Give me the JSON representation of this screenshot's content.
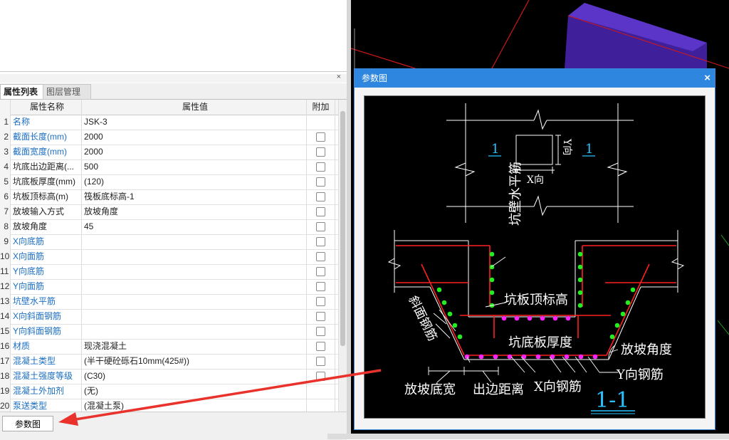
{
  "tabs": {
    "attr_list": "属性列表",
    "layer_mgmt": "图层管理"
  },
  "close_glyph": "×",
  "headers": {
    "name": "属性名称",
    "value": "属性值",
    "extra": "附加"
  },
  "rows": [
    {
      "num": "1",
      "name": "名称",
      "value": "JSK-3",
      "blue": true,
      "check": false
    },
    {
      "num": "2",
      "name": "截面长度(mm)",
      "value": "2000",
      "blue": true,
      "check": true
    },
    {
      "num": "3",
      "name": "截面宽度(mm)",
      "value": "2000",
      "blue": true,
      "check": true
    },
    {
      "num": "4",
      "name": "坑底出边距离(...",
      "value": "500",
      "blue": false,
      "check": true
    },
    {
      "num": "5",
      "name": "坑底板厚度(mm)",
      "value": "(120)",
      "blue": false,
      "check": true
    },
    {
      "num": "6",
      "name": "坑板顶标高(m)",
      "value": "筏板底标高-1",
      "blue": false,
      "check": true
    },
    {
      "num": "7",
      "name": "放坡输入方式",
      "value": "放坡角度",
      "blue": false,
      "check": true
    },
    {
      "num": "8",
      "name": "放坡角度",
      "value": "45",
      "blue": false,
      "check": true
    },
    {
      "num": "9",
      "name": "X向底筋",
      "value": "",
      "blue": true,
      "check": true
    },
    {
      "num": "10",
      "name": "X向面筋",
      "value": "",
      "blue": true,
      "check": true
    },
    {
      "num": "11",
      "name": "Y向底筋",
      "value": "",
      "blue": true,
      "check": true
    },
    {
      "num": "12",
      "name": "Y向面筋",
      "value": "",
      "blue": true,
      "check": true
    },
    {
      "num": "13",
      "name": "坑壁水平筋",
      "value": "",
      "blue": true,
      "check": true
    },
    {
      "num": "14",
      "name": "X向斜面钢筋",
      "value": "",
      "blue": true,
      "check": true
    },
    {
      "num": "15",
      "name": "Y向斜面钢筋",
      "value": "",
      "blue": true,
      "check": true
    },
    {
      "num": "16",
      "name": "材质",
      "value": "现浇混凝土",
      "blue": true,
      "check": true
    },
    {
      "num": "17",
      "name": "混凝土类型",
      "value": "(半干硬砼砾石10mm(425#))",
      "blue": true,
      "check": true
    },
    {
      "num": "18",
      "name": "混凝土强度等级",
      "value": "(C30)",
      "blue": true,
      "check": true
    },
    {
      "num": "19",
      "name": "混凝土外加剂",
      "value": "(无)",
      "blue": true,
      "check": false
    },
    {
      "num": "20",
      "name": "泵送类型",
      "value": "(混凝土泵)",
      "blue": true,
      "check": false
    }
  ],
  "button": {
    "param_diagram": "参数图"
  },
  "dialog": {
    "title": "参数图",
    "close": "×",
    "labels": {
      "section_mark": "1",
      "y_dir": "Y向",
      "x_dir": "X向",
      "wall_horizontal": "坑壁水平筋",
      "slab_top_elev": "坑板顶标高",
      "slope_rebar": "斜面钢筋",
      "slab_thickness": "坑底板厚度",
      "slope_angle": "放坡角度",
      "y_rebar": "Y向钢筋",
      "slope_bottom_width": "放坡底宽",
      "edge_distance": "出边距离",
      "x_rebar": "X向钢筋",
      "section_title": "1-1"
    },
    "colors": {
      "line": "#ffffff",
      "rebar": "#ff2020",
      "dot_green": "#22ee22",
      "dot_magenta": "#ff22ff",
      "accent": "#27c2ff"
    }
  }
}
